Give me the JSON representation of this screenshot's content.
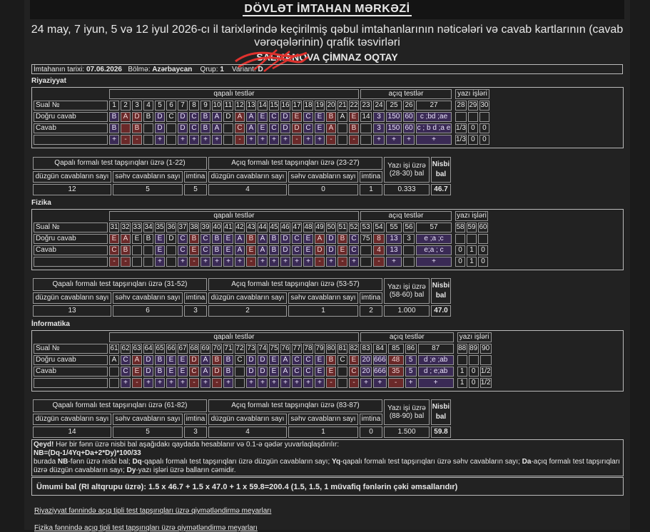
{
  "header": {
    "title": "DÖVLƏT İMTAHAN MƏRKƏZİ",
    "subtitle": "24 may, 7 iyun, 5 və 12 iyul 2026-cı il tarixlərində keçirilmiş qəbul imtahanlarının nəticələri və cavab kartlarının (cavab vərəqələrinin) qrafik təsvirləri",
    "student_name": "SALMANOVA ÇİMNAZ OQTAY"
  },
  "info": {
    "date_label": "İmtahanın tarixi:",
    "date": "07.06.2026",
    "section_label": "Bölmə:",
    "section": "Azərbaycan",
    "group_label": "Qrup:",
    "group": "1",
    "variant_label": "Variant:",
    "variant": "D"
  },
  "labels": {
    "sual": "Sual №",
    "correct": "Doğru cavab",
    "answer": "Cavab",
    "closed": "qapalı testlər",
    "open": "açıq testlər",
    "written": "yazı işləri",
    "correct_count": "düzgün cavabların sayı",
    "wrong_count": "səhv cavabların sayı",
    "skip": "imtina",
    "score": "Nisbi bal"
  },
  "subjects": [
    {
      "name": "Riyaziyyat",
      "closed": {
        "nums": [
          "1",
          "2",
          "3",
          "4",
          "5",
          "6",
          "7",
          "8",
          "9",
          "10",
          "11",
          "12",
          "13",
          "14",
          "15",
          "16",
          "17",
          "18",
          "19",
          "20",
          "21",
          "22"
        ],
        "correct": [
          "B",
          "A",
          "D",
          "B",
          "D",
          "C",
          "D",
          "C",
          "B",
          "A",
          "D",
          "A",
          "A",
          "E",
          "C",
          "D",
          "E",
          "C",
          "E",
          "B",
          "A",
          "E"
        ],
        "answer": [
          "B",
          "",
          "B",
          "",
          "D",
          "",
          "D",
          "C",
          "B",
          "A",
          "",
          "C",
          "A",
          "E",
          "C",
          "D",
          "D",
          "C",
          "E",
          "A",
          "",
          "B"
        ],
        "mark": [
          "+",
          "-",
          "-",
          "",
          "+",
          "",
          "+",
          "+",
          "+",
          "+",
          "",
          "-",
          "+",
          "+",
          "+",
          "+",
          "-",
          "+",
          "+",
          "-",
          "",
          "-"
        ]
      },
      "open": {
        "nums": [
          "23",
          "24",
          "25",
          "26",
          "27"
        ],
        "correct": [
          "14",
          "3",
          "150",
          "60",
          "c ;bd ;ae"
        ],
        "answer": [
          "",
          "3",
          "150",
          "60",
          "c ; b d ;a e"
        ],
        "mark": [
          "",
          "+",
          "+",
          "+",
          "+"
        ]
      },
      "written": {
        "nums": [
          "28",
          "29",
          "30"
        ],
        "answer": [
          "1/3",
          "0",
          "0"
        ],
        "mark": [
          "1/3",
          "0",
          "0"
        ]
      },
      "stats": {
        "closed_title": "Qapalı formalı test tapşırıqları üzrə (1-22)",
        "open_title": "Açıq formalı test tapşırıqları üzrə (23-27)",
        "written_title": "Yazı işi üzrə (28-30) bal",
        "c_correct": "12",
        "c_wrong": "5",
        "c_skip": "5",
        "o_correct": "4",
        "o_wrong": "0",
        "o_skip": "1",
        "written": "0.333",
        "score": "46.7"
      }
    },
    {
      "name": "Fizika",
      "closed": {
        "nums": [
          "31",
          "32",
          "33",
          "34",
          "35",
          "36",
          "37",
          "38",
          "39",
          "40",
          "41",
          "42",
          "43",
          "44",
          "45",
          "46",
          "47",
          "48",
          "49",
          "50",
          "51",
          "52"
        ],
        "correct": [
          "E",
          "A",
          "E",
          "B",
          "E",
          "D",
          "C",
          "B",
          "C",
          "B",
          "E",
          "A",
          "B",
          "A",
          "B",
          "D",
          "C",
          "E",
          "A",
          "D",
          "B",
          "C"
        ],
        "answer": [
          "C",
          "B",
          "",
          "",
          "E",
          "",
          "C",
          "E",
          "C",
          "B",
          "E",
          "A",
          "E",
          "A",
          "B",
          "D",
          "C",
          "E",
          "D",
          "D",
          "E",
          "C"
        ],
        "mark": [
          "-",
          "-",
          "",
          "",
          "+",
          "",
          "+",
          "-",
          "+",
          "+",
          "+",
          "+",
          "-",
          "+",
          "+",
          "+",
          "+",
          "+",
          "-",
          "+",
          "-",
          "+"
        ]
      },
      "open": {
        "nums": [
          "53",
          "54",
          "55",
          "56",
          "57"
        ],
        "correct": [
          "75",
          "8",
          "13",
          "3",
          "e ;a ;c"
        ],
        "answer": [
          "",
          "4",
          "13",
          "",
          "e;a ; c"
        ],
        "mark": [
          "",
          "-",
          "+",
          "",
          "+"
        ]
      },
      "written": {
        "nums": [
          "58",
          "59",
          "60"
        ],
        "answer": [
          "0",
          "1",
          "0"
        ],
        "mark": [
          "0",
          "1",
          "0"
        ]
      },
      "stats": {
        "closed_title": "Qapalı formalı test tapşırıqları üzrə (31-52)",
        "open_title": "Açıq formalı test tapşırıqları üzrə (53-57)",
        "written_title": "Yazı işi üzrə (58-60) bal",
        "c_correct": "13",
        "c_wrong": "6",
        "c_skip": "3",
        "o_correct": "2",
        "o_wrong": "1",
        "o_skip": "2",
        "written": "1.000",
        "score": "47.0"
      }
    },
    {
      "name": "İnformatika",
      "closed": {
        "nums": [
          "61",
          "62",
          "63",
          "64",
          "65",
          "66",
          "67",
          "68",
          "69",
          "70",
          "71",
          "72",
          "73",
          "74",
          "75",
          "76",
          "77",
          "78",
          "79",
          "80",
          "81",
          "82"
        ],
        "correct": [
          "A",
          "C",
          "A",
          "D",
          "B",
          "E",
          "E",
          "D",
          "A",
          "B",
          "B",
          "C",
          "D",
          "D",
          "E",
          "A",
          "C",
          "C",
          "E",
          "B",
          "C",
          "E"
        ],
        "answer": [
          "",
          "C",
          "E",
          "D",
          "B",
          "E",
          "E",
          "C",
          "A",
          "D",
          "B",
          "",
          "D",
          "D",
          "E",
          "A",
          "C",
          "C",
          "E",
          "E",
          "",
          "C"
        ],
        "mark": [
          "",
          "+",
          "-",
          "+",
          "+",
          "+",
          "+",
          "-",
          "+",
          "-",
          "+",
          "",
          "+",
          "+",
          "+",
          "+",
          "+",
          "+",
          "+",
          "-",
          "",
          "-"
        ]
      },
      "open": {
        "nums": [
          "83",
          "84",
          "85",
          "86",
          "87"
        ],
        "correct": [
          "20",
          "666",
          "48",
          "5",
          "d ;e ;ab"
        ],
        "answer": [
          "20",
          "666",
          "35",
          "5",
          "d ; e;ab"
        ],
        "mark": [
          "+",
          "+",
          "-",
          "+",
          "+"
        ]
      },
      "written": {
        "nums": [
          "88",
          "89",
          "90"
        ],
        "answer": [
          "1",
          "0",
          "1/2"
        ],
        "mark": [
          "1",
          "0",
          "1/2"
        ]
      },
      "stats": {
        "closed_title": "Qapalı formalı test tapşırıqları üzrə (61-82)",
        "open_title": "Açıq formalı test tapşırıqları üzrə (83-87)",
        "written_title": "Yazı işi üzrə (88-90) bal",
        "c_correct": "14",
        "c_wrong": "5",
        "c_skip": "3",
        "o_correct": "4",
        "o_wrong": "1",
        "o_skip": "0",
        "written": "1.500",
        "score": "59.8"
      }
    }
  ],
  "note": {
    "lead": "Qeyd!",
    "line1": " Hər bir fənn üzrə nisbi bal aşağıdakı qaydada hesablanır və 0.1-ə qədər yuvarlaqlaşdırılır:",
    "formula": "NB=(Dq-1/4Yq+Da+2*Dy)*100/33",
    "p0": "burada ",
    "k1": "NB",
    "p1": "-fənn üzrə nisbi bal; ",
    "k2": "Dq",
    "p2": "-qapalı formalı test tapşırıqları üzrə düzgün cavabların sayı; ",
    "k3": "Yq",
    "p3": "-qapalı formalı test tapşırıqları üzrə səhv cavabların sayı; ",
    "k4": "Da",
    "p4": "-açıq formalı test tapşırıqları üzrə düzgün cavabların sayı; ",
    "k5": "Dy",
    "p5": "-yazı işləri üzrə balların cəmidir."
  },
  "total": "Ümumi bal (RI altqrupu üzrə): 1.5 x 46.7 + 1.5 x 47.0 + 1 x 59.8=200.4 (1.5, 1.5, 1 müvafiq fənlərin çəki əmsallarıdır)",
  "links": [
    "Riyaziyyat fənnində açıq tipli test tapşırıqları üzrə qiymətləndirmə meyarları",
    "Fizika fənnində açıq tipli test tapşırıqları üzrə qiymətləndirmə meyarları"
  ]
}
